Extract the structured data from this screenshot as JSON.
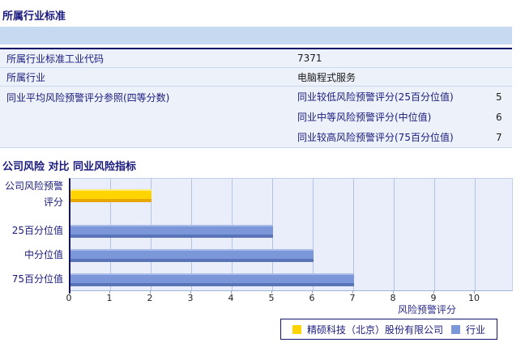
{
  "section1": {
    "title": "所属行业标准",
    "table": {
      "rows": [
        {
          "label": "所属行业标准工业代码",
          "value": "7371"
        },
        {
          "label": "所属行业",
          "value": "电脑程式服务"
        }
      ],
      "group": {
        "label": "同业平均风险预警评分参照(四等分数)",
        "sub_rows": [
          {
            "label": "同业较低风险预警评分(25百分位值)",
            "value": "5"
          },
          {
            "label": "同业中等风险预警评分(中位值)",
            "value": "6"
          },
          {
            "label": "同业较高风险预警评分(75百分位值)",
            "value": "7"
          }
        ]
      }
    }
  },
  "section2": {
    "title": "公司风险 对比 同业风险指标"
  },
  "chart_data": {
    "type": "bar",
    "orientation": "horizontal",
    "title": "公司风险 对比 同业风险指标",
    "categories": [
      "公司风险预警评分",
      "25百分位值",
      "中分位值",
      "75百分位值"
    ],
    "series": [
      {
        "name": "精硕科技（北京）股份有限公司",
        "color": "#ffd400",
        "values": [
          2,
          null,
          null,
          null
        ]
      },
      {
        "name": "行业",
        "color": "#7b96d9",
        "values": [
          null,
          5,
          6,
          7
        ]
      }
    ],
    "xlabel": "风险预警评分",
    "xlim": [
      0,
      10
    ],
    "ticks": [
      0,
      1,
      2,
      3,
      4,
      5,
      6,
      7,
      8,
      9,
      10
    ],
    "grid": true,
    "legend_position": "bottom"
  },
  "colors": {
    "title_navy": "#1a1a7e",
    "table_header_band": "#c6d9f1",
    "table_header_rule": "#00006b",
    "table_row_bg": "#edf1f9",
    "table_row_border": "#c9d9ee",
    "plot_bg": "#e9eefa",
    "gridline": "#b3c3e6",
    "axis": "#15156b",
    "bar_yellow": "#ffd400",
    "bar_yellow_edge": "#e8a700",
    "bar_blue": "#7b96d9",
    "bar_blue_edge": "#5a74b8",
    "value_text": "#1c1c1c"
  }
}
